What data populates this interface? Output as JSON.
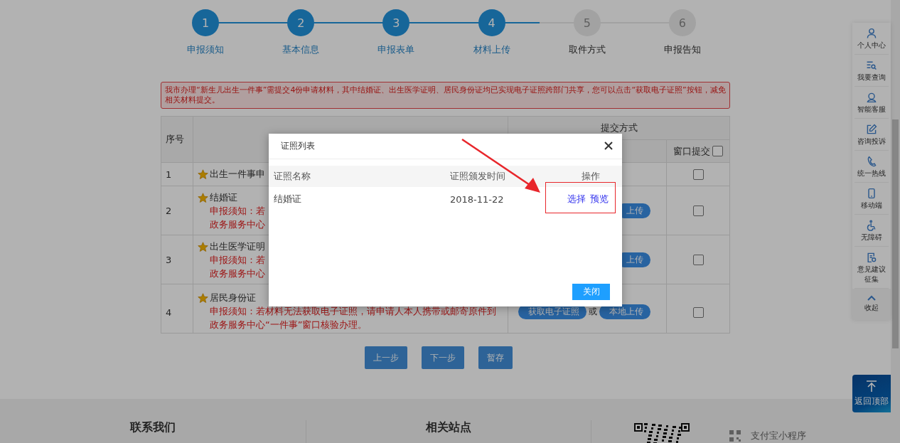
{
  "steps": [
    {
      "number": "1",
      "label": "申报须知",
      "done": true
    },
    {
      "number": "2",
      "label": "基本信息",
      "done": true
    },
    {
      "number": "3",
      "label": "申报表单",
      "done": true
    },
    {
      "number": "4",
      "label": "材料上传",
      "done": true
    },
    {
      "number": "5",
      "label": "取件方式",
      "done": false
    },
    {
      "number": "6",
      "label": "申报告知",
      "done": false
    }
  ],
  "notice": "我市办理“新生儿出生一件事”需提交4份申请材料，其中结婚证、出生医学证明、居民身份证均已实现电子证照跨部门共享，您可以点击“获取电子证照”按钮，减免相关材料提交。",
  "table": {
    "index_header": "序号",
    "submit_header": "提交方式",
    "window_header": "窗口提交",
    "window_all_checked": false,
    "rows": [
      {
        "index": "1",
        "name": "出生一件事申",
        "notes": [],
        "submit": [],
        "window_checked": false
      },
      {
        "index": "2",
        "name": "结婚证",
        "notes": [
          "申报须知：若",
          "政务服务中心"
        ],
        "submit": [
          {
            "kind": "button",
            "text": "上传"
          }
        ],
        "window_checked": false
      },
      {
        "index": "3",
        "name": "出生医学证明",
        "notes": [
          "申报须知：若",
          "政务服务中心"
        ],
        "submit": [
          {
            "kind": "button",
            "text": "上传"
          }
        ],
        "window_checked": false
      },
      {
        "index": "4",
        "name": "居民身份证",
        "notes": [
          "申报须知：若材料无法获取电子证照，请申请人本人携带或邮寄原件到",
          "政务服务中心“一件事”窗口核验办理。"
        ],
        "submit": [
          {
            "kind": "button",
            "text": "获取电子证照"
          },
          {
            "kind": "text",
            "text": "或"
          },
          {
            "kind": "button",
            "text": "本地上传"
          }
        ],
        "window_checked": false
      }
    ]
  },
  "buttons": [
    "上一步",
    "下一步",
    "暂存"
  ],
  "footer": {
    "sections": [
      "联系我们",
      "相关站点"
    ],
    "mini_program": "支付宝小程序"
  },
  "sidebar": {
    "items": [
      "个人中心",
      "我要查询",
      "智能客服",
      "咨询投诉",
      "统一热线",
      "移动端",
      "无障碍",
      "意见建议征集"
    ],
    "collapse": "收起",
    "back_to_top": "返回顶部"
  },
  "dialog": {
    "title": "证照列表",
    "columns": [
      "证照名称",
      "证照颁发时间",
      "操作"
    ],
    "rows": [
      {
        "name": "结婚证",
        "date": "2018-11-22",
        "actions": [
          "选择",
          "预览"
        ]
      }
    ],
    "close": "关闭"
  }
}
